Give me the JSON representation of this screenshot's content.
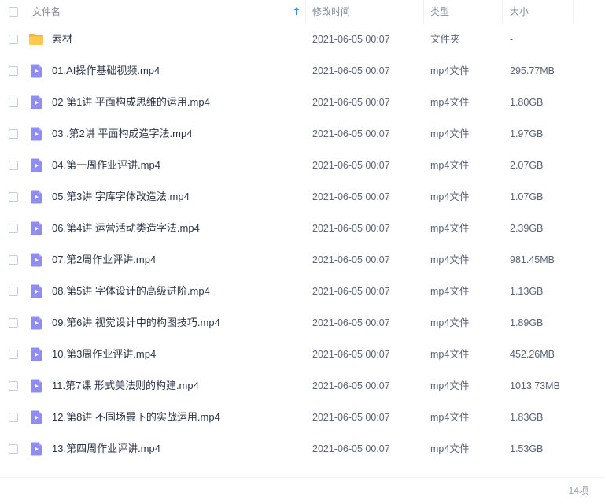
{
  "header": {
    "name_label": "文件名",
    "time_label": "修改时间",
    "type_label": "类型",
    "size_label": "大小",
    "sort_icon": "arrow-up-icon"
  },
  "icons": {
    "folder": "folder-icon",
    "video": "video-file-icon"
  },
  "colors": {
    "folder": "#ffc94d",
    "video": "#8f8cf3"
  },
  "rows": [
    {
      "kind": "folder",
      "name": "素材",
      "time": "2021-06-05 00:07",
      "type": "文件夹",
      "size": "-"
    },
    {
      "kind": "video",
      "name": "01.AI操作基础视频.mp4",
      "time": "2021-06-05 00:07",
      "type": "mp4文件",
      "size": "295.77MB"
    },
    {
      "kind": "video",
      "name": "02 第1讲 平面构成思维的运用.mp4",
      "time": "2021-06-05 00:07",
      "type": "mp4文件",
      "size": "1.80GB"
    },
    {
      "kind": "video",
      "name": "03 .第2讲 平面构成造字法.mp4",
      "time": "2021-06-05 00:07",
      "type": "mp4文件",
      "size": "1.97GB"
    },
    {
      "kind": "video",
      "name": "04.第一周作业评讲.mp4",
      "time": "2021-06-05 00:07",
      "type": "mp4文件",
      "size": "2.07GB"
    },
    {
      "kind": "video",
      "name": "05.第3讲 字库字体改造法.mp4",
      "time": "2021-06-05 00:07",
      "type": "mp4文件",
      "size": "1.07GB"
    },
    {
      "kind": "video",
      "name": "06.第4讲 运营活动类造字法.mp4",
      "time": "2021-06-05 00:07",
      "type": "mp4文件",
      "size": "2.39GB"
    },
    {
      "kind": "video",
      "name": "07.第2周作业评讲.mp4",
      "time": "2021-06-05 00:07",
      "type": "mp4文件",
      "size": "981.45MB"
    },
    {
      "kind": "video",
      "name": "08.第5讲 字体设计的高级进阶.mp4",
      "time": "2021-06-05 00:07",
      "type": "mp4文件",
      "size": "1.13GB"
    },
    {
      "kind": "video",
      "name": "09.第6讲 视觉设计中的构图技巧.mp4",
      "time": "2021-06-05 00:07",
      "type": "mp4文件",
      "size": "1.89GB"
    },
    {
      "kind": "video",
      "name": "10.第3周作业评讲.mp4",
      "time": "2021-06-05 00:07",
      "type": "mp4文件",
      "size": "452.26MB"
    },
    {
      "kind": "video",
      "name": "11.第7课 形式美法则的构建.mp4",
      "time": "2021-06-05 00:07",
      "type": "mp4文件",
      "size": "1013.73MB"
    },
    {
      "kind": "video",
      "name": "12.第8讲 不同场景下的实战运用.mp4",
      "time": "2021-06-05 00:07",
      "type": "mp4文件",
      "size": "1.83GB"
    },
    {
      "kind": "video",
      "name": "13.第四周作业评讲.mp4",
      "time": "2021-06-05 00:07",
      "type": "mp4文件",
      "size": "1.53GB"
    }
  ],
  "footer": {
    "count_text": "14项"
  }
}
